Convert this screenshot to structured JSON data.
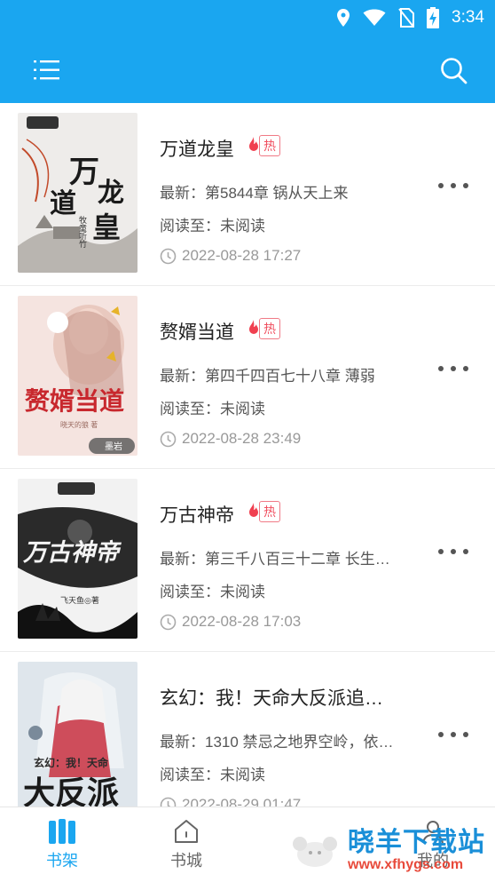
{
  "status_bar": {
    "time": "3:34",
    "icons": [
      "location-icon",
      "wifi-icon",
      "no-sim-icon",
      "battery-charging-icon"
    ]
  },
  "app_bar": {
    "menu_icon": "menu-icon",
    "search_icon": "search-icon",
    "background": "#1aa6f0"
  },
  "books": [
    {
      "title": "万道龙皇",
      "hot": "热",
      "latest": "最新：第5844章 锅从天上来",
      "progress": "阅读至：未阅读",
      "time": "2022-08-28 17:27",
      "cover_text": "万道龙皇",
      "cover_author": "牧童听竹"
    },
    {
      "title": "赘婿当道",
      "hot": "热",
      "latest": "最新：第四千四百七十八章 薄弱",
      "progress": "阅读至：未阅读",
      "time": "2022-08-28 23:49",
      "cover_text": "赘婿当道",
      "cover_author": "墨岩"
    },
    {
      "title": "万古神帝",
      "hot": "热",
      "latest": "最新：第三千八百三十二章 长生…",
      "progress": "阅读至：未阅读",
      "time": "2022-08-28 17:03",
      "cover_text": "万古神帝",
      "cover_author": "飞天鱼◎著"
    },
    {
      "title": "玄幻：我！天命大反派追…",
      "hot": "",
      "latest": "最新：1310 禁忌之地界空岭，依…",
      "progress": "阅读至：未阅读",
      "time": "2022-08-29 01:47",
      "cover_text": "大反派",
      "cover_author": ""
    }
  ],
  "tabs": [
    {
      "label": "书架",
      "icon": "bookshelf-icon",
      "active": true
    },
    {
      "label": "书城",
      "icon": "home-icon",
      "active": false
    },
    {
      "label": "我的",
      "icon": "profile-icon",
      "active": false
    }
  ],
  "watermark": {
    "text": "晓羊下载站",
    "url": "www.xfhygs.com"
  },
  "colors": {
    "accent": "#1aa6f0",
    "hot": "#f05060"
  }
}
